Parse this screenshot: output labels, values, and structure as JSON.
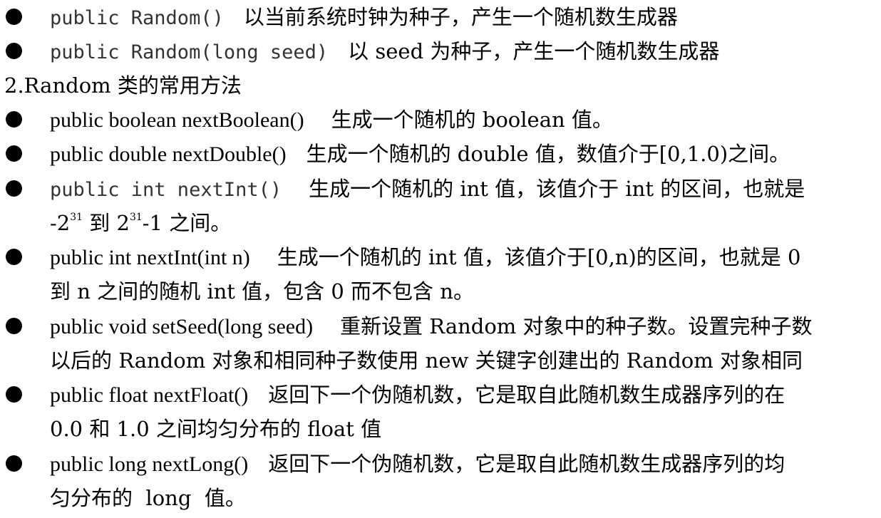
{
  "items": [
    {
      "code": "public Random()",
      "desc": "以当前系统时钟为种子，产生一个随机数生成器"
    },
    {
      "code": "public Random(long seed)",
      "desc": "以 seed 为种子，产生一个随机数生成器"
    }
  ],
  "section_title": "2.Random 类的常用方法",
  "methods": [
    {
      "code": "public boolean nextBoolean()",
      "desc": "生成一个随机的 boolean 值。"
    },
    {
      "code": "public double nextDouble()",
      "desc": "生成一个随机的 double 值，数值介于[0,1.0)之间。"
    },
    {
      "code": "public int nextInt()",
      "desc": "生成一个随机的 int 值，该值介于 int 的区间，也就是",
      "cont_pre": "-2",
      "cont_sup1": "31",
      "cont_mid": " 到 2",
      "cont_sup2": "31",
      "cont_post": "-1 之间。"
    },
    {
      "code": "public int nextInt(int n)",
      "desc": "生成一个随机的 int 值，该值介于[0,n)的区间，也就是 0",
      "cont": "到 n 之间的随机 int 值，包含 0 而不包含 n。"
    },
    {
      "code": "public void setSeed(long seed)",
      "desc": "重新设置 Random 对象中的种子数。设置完种子数",
      "cont": "以后的 Random 对象和相同种子数使用 new 关键字创建出的 Random 对象相同"
    },
    {
      "code": "public float nextFloat()",
      "desc": "返回下一个伪随机数，它是取自此随机数生成器序列的在",
      "cont": "0.0 和 1.0 之间均匀分布的 float 值"
    },
    {
      "code": "public long nextLong()",
      "desc": "返回下一个伪随机数，它是取自此随机数生成器序列的均",
      "cont": "匀分布的  long  值。"
    }
  ]
}
